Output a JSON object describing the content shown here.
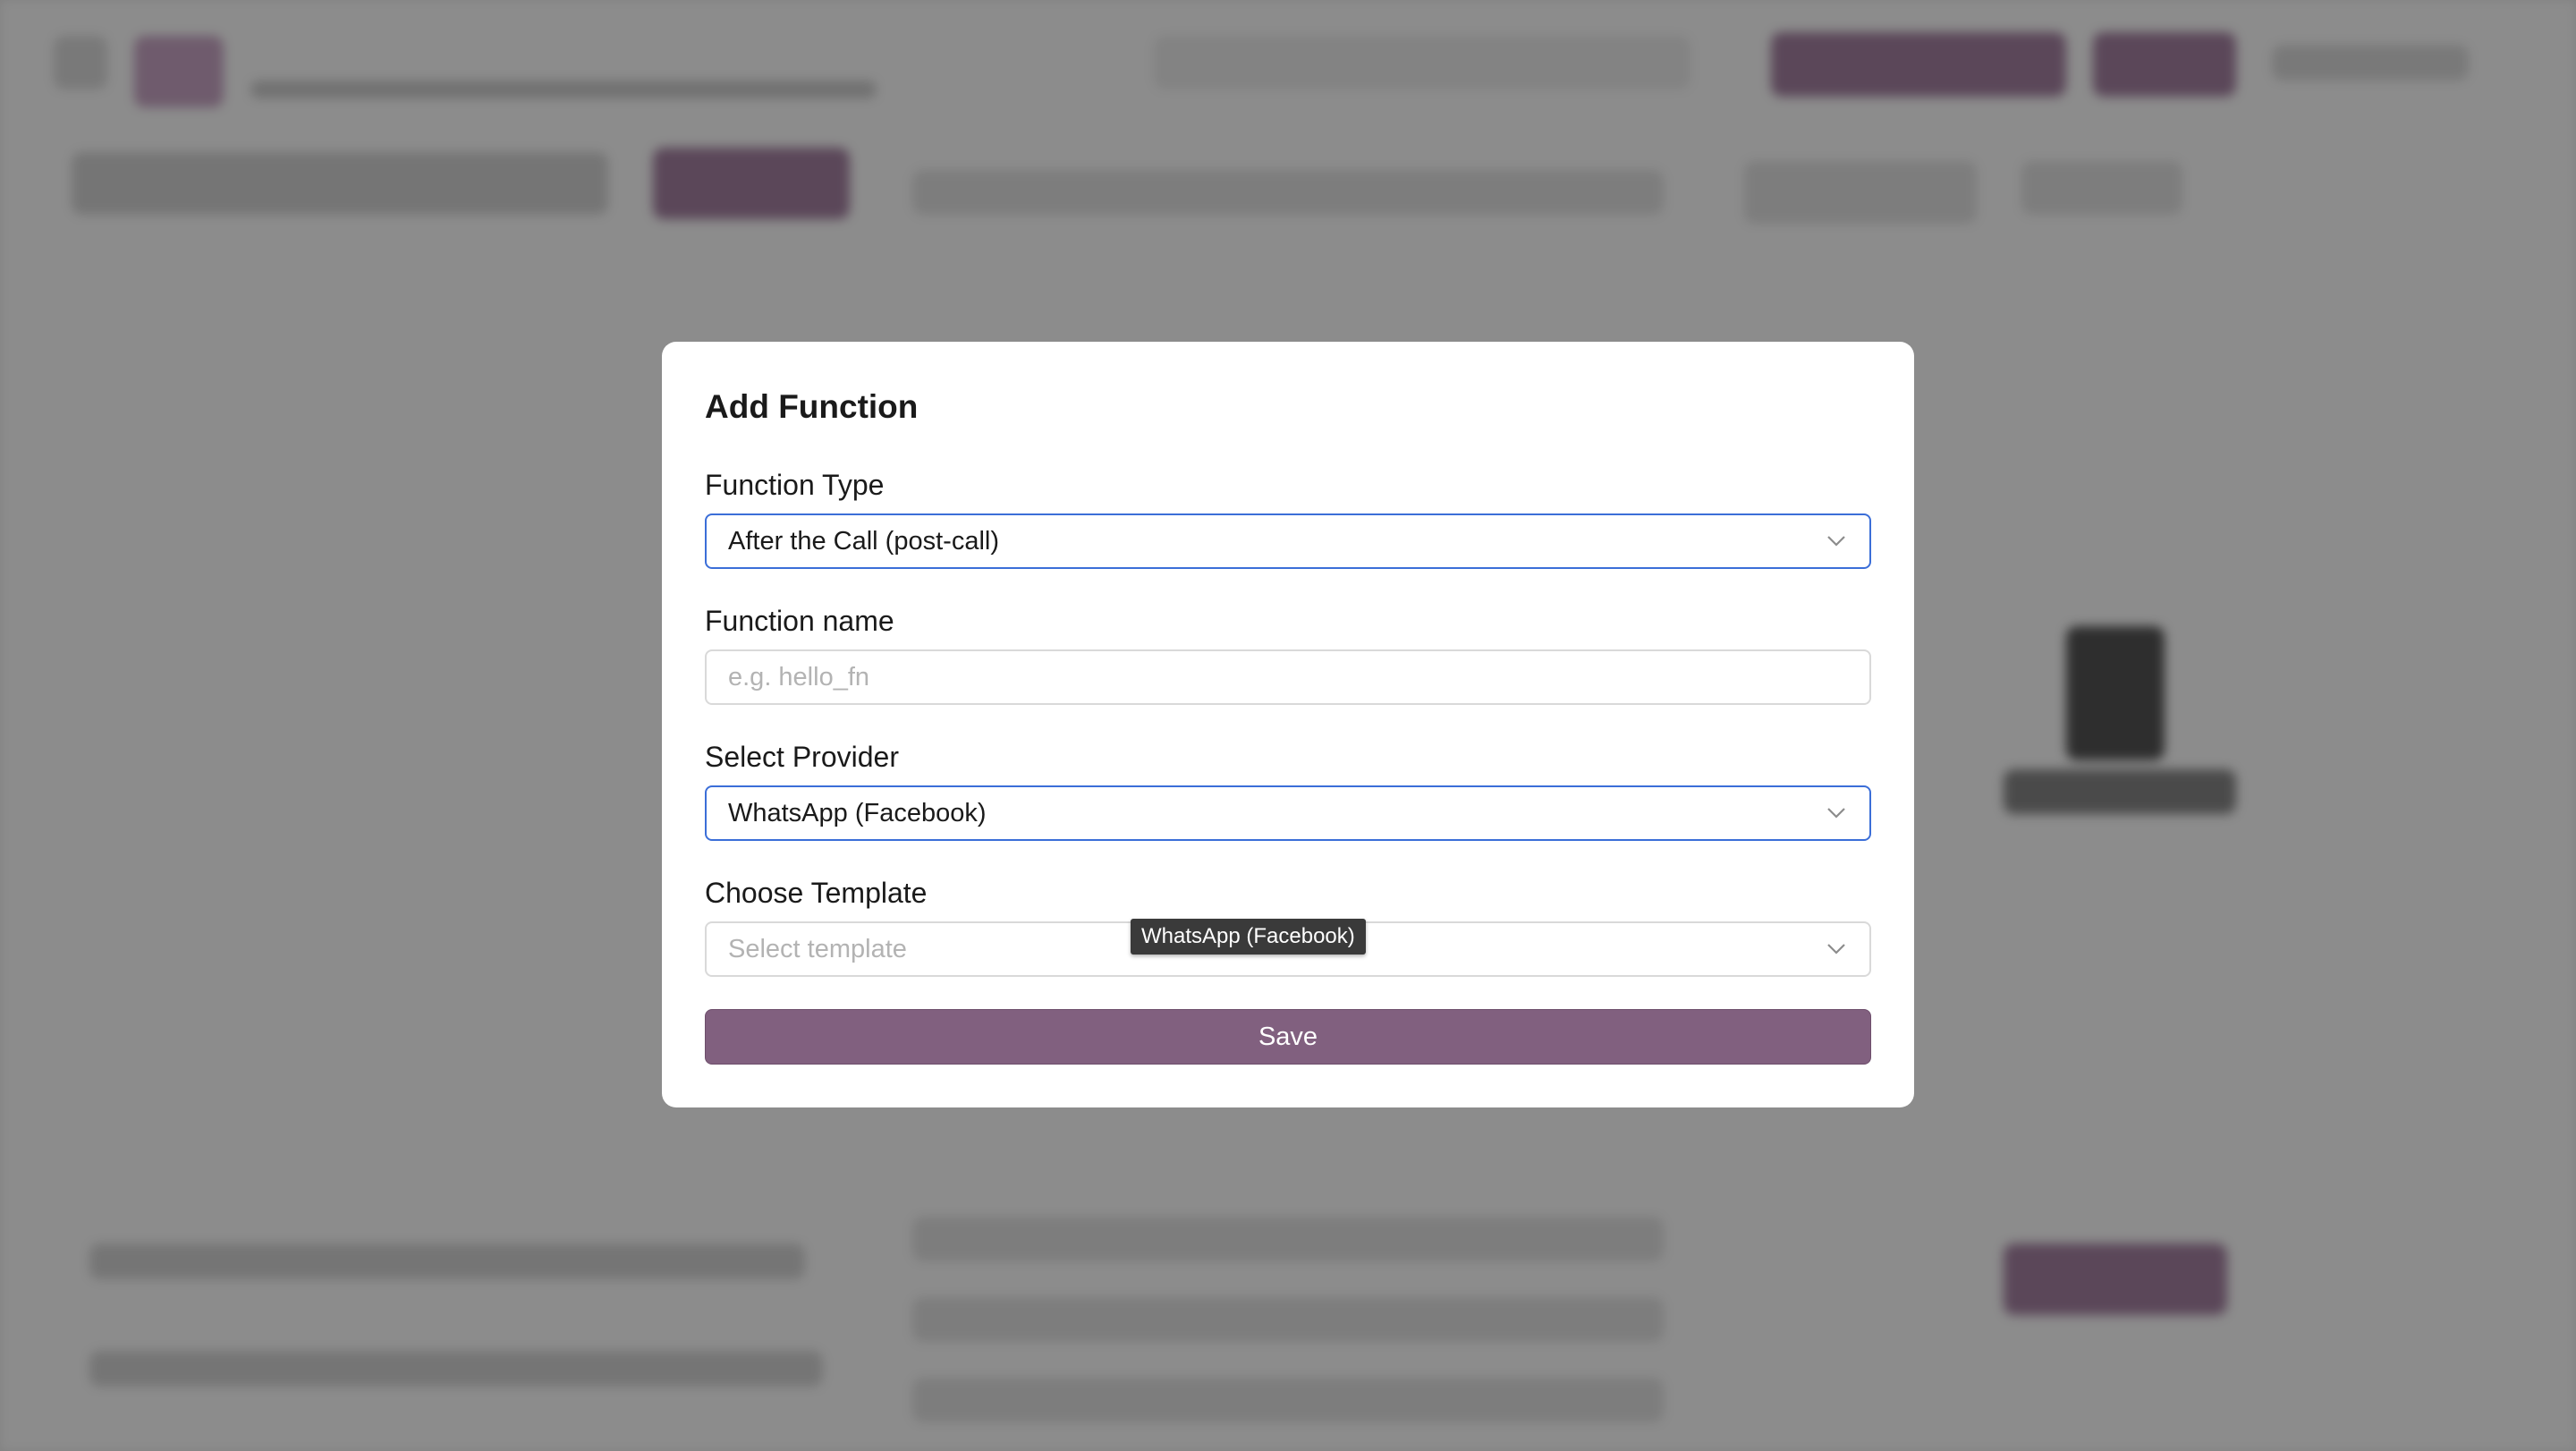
{
  "modal": {
    "title": "Add Function",
    "function_type": {
      "label": "Function Type",
      "selected": "After the Call (post-call)"
    },
    "function_name": {
      "label": "Function name",
      "value": "",
      "placeholder": "e.g. hello_fn"
    },
    "provider": {
      "label": "Select Provider",
      "selected": "WhatsApp (Facebook)"
    },
    "template": {
      "label": "Choose Template",
      "placeholder": "Select template"
    },
    "save_label": "Save"
  },
  "tooltip": {
    "text": "WhatsApp (Facebook)"
  },
  "colors": {
    "accent": "#81607f",
    "focus_border": "#3b6ed8",
    "overlay": "rgba(0,0,0,0.45)"
  },
  "icons": {
    "dropdown": "chevron-down-icon"
  }
}
